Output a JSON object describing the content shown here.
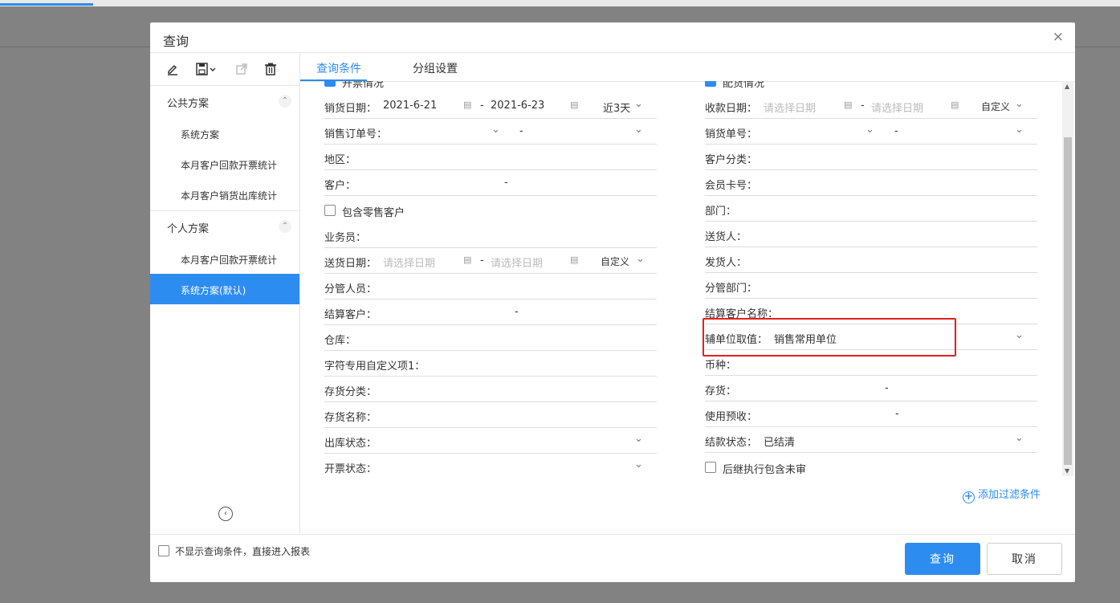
{
  "dialog": {
    "title": "查询",
    "close_label": "×"
  },
  "sidebar": {
    "public_title": "公共方案",
    "public_items": [
      "系统方案",
      "本月客户回款开票统计",
      "本月客户销货出库统计"
    ],
    "personal_title": "个人方案",
    "personal_items": [
      "本月客户回款开票统计",
      "系统方案(默认)"
    ]
  },
  "tabs": [
    "查询条件",
    "分组设置"
  ],
  "left_col": {
    "top_checkbox": "开票情况",
    "sale_date": {
      "label": "销货日期：",
      "start": "2021-6-21",
      "sep": "-",
      "end": "2021-6-23",
      "range": "近3天"
    },
    "sale_order": {
      "label": "销售订单号：",
      "sep": "-"
    },
    "region": {
      "label": "地区："
    },
    "customer": {
      "label": "客户：",
      "sep": "-"
    },
    "include_retail": "包含零售客户",
    "salesman": {
      "label": "业务员："
    },
    "delivery_date": {
      "label": "送货日期：",
      "start_ph": "请选择日期",
      "sep": "-",
      "end_ph": "请选择日期",
      "range": "自定义"
    },
    "manager": {
      "label": "分管人员："
    },
    "settle_customer": {
      "label": "结算客户：",
      "sep": "-"
    },
    "warehouse": {
      "label": "仓库："
    },
    "custom_item": {
      "label": "字符专用自定义项1："
    },
    "inventory_class": {
      "label": "存货分类："
    },
    "inventory_name": {
      "label": "存货名称："
    },
    "outbound_status": {
      "label": "出库状态："
    },
    "invoice_status": {
      "label": "开票状态："
    }
  },
  "right_col": {
    "top_checkbox": "配货情况",
    "receipt_date": {
      "label": "收款日期：",
      "start_ph": "请选择日期",
      "sep": "-",
      "end_ph": "请选择日期",
      "range": "自定义"
    },
    "sale_no": {
      "label": "销货单号：",
      "sep": "-"
    },
    "customer_class": {
      "label": "客户分类："
    },
    "member_card": {
      "label": "会员卡号："
    },
    "dept": {
      "label": "部门："
    },
    "deliverer": {
      "label": "送货人："
    },
    "shipper": {
      "label": "发货人："
    },
    "manage_dept": {
      "label": "分管部门："
    },
    "settle_name": {
      "label": "结算客户名称："
    },
    "aux_unit": {
      "label": "辅单位取值：",
      "value": "销售常用单位"
    },
    "currency": {
      "label": "币种："
    },
    "inventory": {
      "label": "存货：",
      "sep": "-"
    },
    "prepay": {
      "label": "使用预收：",
      "sep": "-"
    },
    "settle_status": {
      "label": "结款状态：",
      "value": "已结清"
    },
    "include_unaudited": "后继执行包含未审"
  },
  "add_filter": "添加过滤条件",
  "footer": {
    "skip_label": "不显示查询条件，直接进入报表",
    "query_button": "查询",
    "cancel_button": "取消"
  },
  "colors": {
    "accent": "#2d8cf0",
    "highlight": "#e02020"
  }
}
